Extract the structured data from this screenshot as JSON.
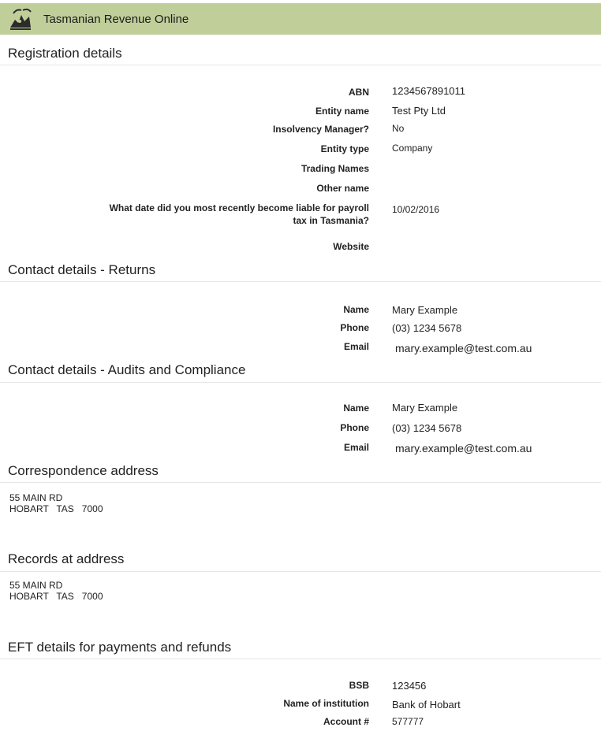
{
  "app": {
    "title": "Tasmanian Revenue Online"
  },
  "registration": {
    "heading": "Registration details",
    "fields": [
      {
        "label": "ABN",
        "value": "1234567891011"
      },
      {
        "label": "Entity name",
        "value": "Test Pty Ltd"
      },
      {
        "label": "Insolvency Manager?",
        "value": "No"
      },
      {
        "label": "Entity type",
        "value": "Company"
      },
      {
        "label": "Trading Names",
        "value": ""
      },
      {
        "label": "Other name",
        "value": ""
      },
      {
        "label": "What date did you most recently become liable for payroll tax in Tasmania?",
        "value": "10/02/2016"
      },
      {
        "label": "Website",
        "value": ""
      }
    ]
  },
  "contact_returns": {
    "heading": "Contact details - Returns",
    "fields": [
      {
        "label": "Name",
        "value": "Mary Example"
      },
      {
        "label": "Phone",
        "value": "(03) 1234 5678"
      },
      {
        "label": "Email",
        "value": "mary.example@test.com.au"
      }
    ]
  },
  "contact_audits": {
    "heading": "Contact details - Audits and Compliance",
    "fields": [
      {
        "label": "Name",
        "value": "Mary Example"
      },
      {
        "label": "Phone",
        "value": "(03) 1234 5678"
      },
      {
        "label": "Email",
        "value": "mary.example@test.com.au"
      }
    ]
  },
  "correspondence": {
    "heading": "Correspondence address",
    "line1": "55 MAIN RD",
    "line2": "HOBART   TAS   7000"
  },
  "records": {
    "heading": "Records at address",
    "line1": "55 MAIN RD",
    "line2": "HOBART   TAS   7000"
  },
  "eft": {
    "heading": "EFT details for payments and refunds",
    "fields": [
      {
        "label": "BSB",
        "value": "123456"
      },
      {
        "label": "Name of institution",
        "value": "Bank of Hobart"
      },
      {
        "label": "Account #",
        "value": "577777"
      }
    ]
  },
  "colors": {
    "header_bg": "#c0cf9a",
    "rule": "#e6e6e6"
  },
  "icons": {
    "logo": "tasmanian-devil-logo-icon"
  }
}
